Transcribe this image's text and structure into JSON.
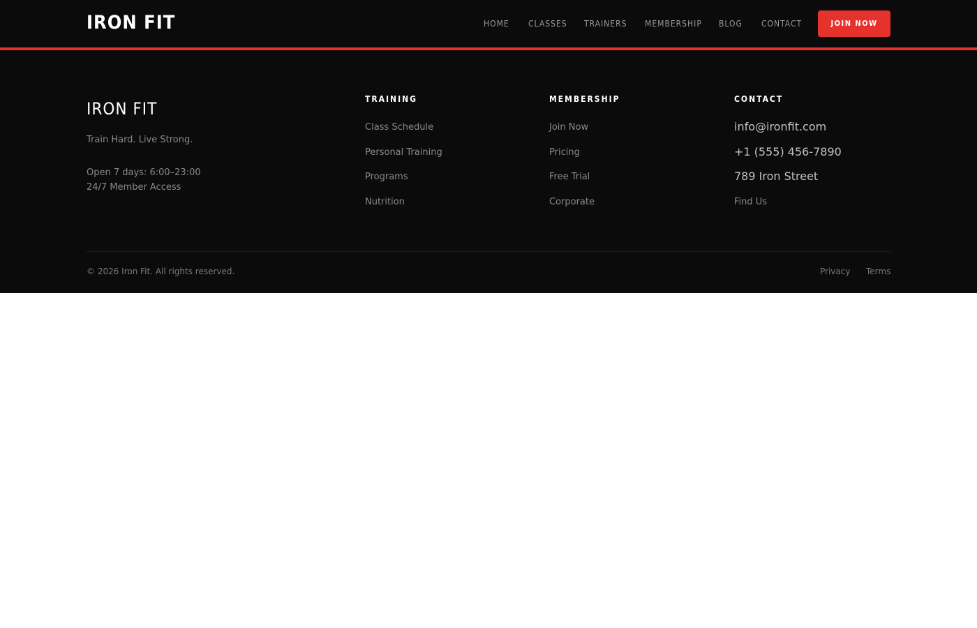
{
  "colors": {
    "accent": "#e5322d",
    "background": "#0b0b0c",
    "heading": "#ffffff",
    "muted_text": "#8a8a8a",
    "contact_text": "#bfc1c6",
    "page_background": "#ffffff"
  },
  "header": {
    "logo": "IRON FIT",
    "nav": [
      "HOME",
      "CLASSES",
      "TRAINERS",
      "MEMBERSHIP",
      "BLOG",
      "CONTACT"
    ],
    "cta_label": "JOIN NOW"
  },
  "footer": {
    "brand": {
      "name": "IRON FIT",
      "tagline": "Train Hard. Live Strong.",
      "hours": "Open 7 days: 6:00–23:00",
      "access": "24/7 Member Access"
    },
    "columns": [
      {
        "heading": "TRAINING",
        "links": [
          "Class Schedule",
          "Personal Training",
          "Programs",
          "Nutrition"
        ]
      },
      {
        "heading": "MEMBERSHIP",
        "links": [
          "Join Now",
          "Pricing",
          "Free Trial",
          "Corporate"
        ]
      },
      {
        "heading": "CONTACT",
        "email": "info@ironfit.com",
        "phone": "+1 (555) 456-7890",
        "address": "789 Iron Street",
        "find_us": "Find Us"
      }
    ],
    "copyright": "© 2026 Iron Fit. All rights reserved.",
    "legal_links": [
      "Privacy",
      "Terms"
    ]
  }
}
